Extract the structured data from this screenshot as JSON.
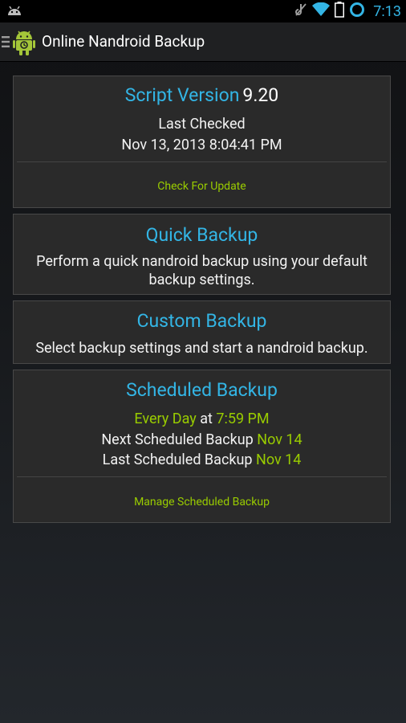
{
  "status_bar": {
    "time": "7:13",
    "icons": [
      "android-notification-icon",
      "silent-icon",
      "wifi-icon",
      "battery-icon",
      "sync-circle-icon"
    ]
  },
  "action_bar": {
    "title": "Online Nandroid Backup"
  },
  "cards": {
    "script_version": {
      "title_label": "Script Version",
      "version": "9.20",
      "last_checked_label": "Last Checked",
      "last_checked_date": "Nov 13, 2013 8:04:41 PM",
      "action": "Check For Update"
    },
    "quick_backup": {
      "title": "Quick Backup",
      "description_line1": "Perform a quick nandroid backup using your default",
      "description_line2": "backup settings."
    },
    "custom_backup": {
      "title": "Custom Backup",
      "description": "Select backup settings and start a nandroid backup."
    },
    "scheduled_backup": {
      "title": "Scheduled Backup",
      "frequency": "Every Day",
      "at_label": "at",
      "time": "7:59 PM",
      "next_label": "Next Scheduled Backup",
      "next_date": "Nov 14",
      "last_label": "Last Scheduled Backup",
      "last_date": "Nov 14",
      "action": "Manage Scheduled Backup"
    }
  },
  "colors": {
    "accent_blue": "#33b5e5",
    "accent_green": "#99cc00",
    "card_bg": "#2a2a2a"
  }
}
